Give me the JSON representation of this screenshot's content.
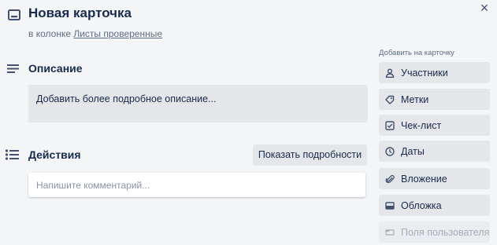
{
  "card": {
    "title": "Новая карточка",
    "list_prefix": "в колонке",
    "list_name": "Листы проверенные",
    "close_glyph": "×"
  },
  "description": {
    "heading": "Описание",
    "placeholder": "Добавить более подробное описание..."
  },
  "activity": {
    "heading": "Действия",
    "show_details_label": "Показать подробности",
    "comment_placeholder": "Напишите комментарий..."
  },
  "sidebar": {
    "add_to_card_label": "Добавить на карточку",
    "buttons": [
      {
        "label": "Участники",
        "icon": "person-icon"
      },
      {
        "label": "Метки",
        "icon": "tag-icon"
      },
      {
        "label": "Чек-лист",
        "icon": "checkbox-icon"
      },
      {
        "label": "Даты",
        "icon": "clock-icon"
      },
      {
        "label": "Вложение",
        "icon": "paperclip-icon"
      },
      {
        "label": "Обложка",
        "icon": "cover-icon"
      },
      {
        "label": "Поля пользователя",
        "icon": "custom-fields-icon"
      }
    ]
  },
  "colors": {
    "background": "#f4f5f7",
    "button_bg": "#e4e6ea",
    "text": "#172b4d",
    "muted_text": "#5e6c84",
    "disabled_text": "#a5adba"
  }
}
